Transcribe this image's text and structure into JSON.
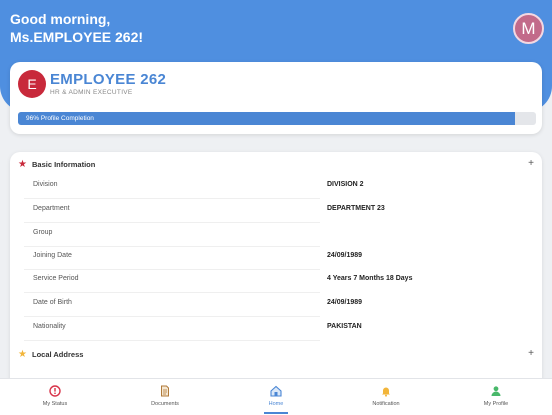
{
  "header": {
    "greeting_line1": "Good morning,",
    "greeting_line2": "Ms.EMPLOYEE 262!",
    "avatar_initial": "M",
    "background_color": "#4f8fe0"
  },
  "profile": {
    "initial": "E",
    "name": "EMPLOYEE 262",
    "role": "HR & ADMIN EXECUTIVE",
    "completion_percent": 96,
    "completion_label": "96% Profile Completion"
  },
  "sections": {
    "basic": {
      "title": "Basic Information",
      "icon": "star-icon",
      "icon_color": "#c8293b",
      "rows": [
        {
          "label": "Division",
          "value": "DIVISION 2"
        },
        {
          "label": "Department",
          "value": "DEPARTMENT 23"
        },
        {
          "label": "Group",
          "value": ""
        },
        {
          "label": "Joining Date",
          "value": "24/09/1989"
        },
        {
          "label": "Service Period",
          "value": "4 Years 7 Months 18 Days"
        },
        {
          "label": "Date of Birth",
          "value": "24/09/1989"
        },
        {
          "label": "Nationality",
          "value": "PAKISTAN"
        }
      ]
    },
    "local_address": {
      "title": "Local Address",
      "icon": "star-icon",
      "icon_color": "#f2b53a"
    }
  },
  "bottom_nav": {
    "items": [
      {
        "label": "My Status",
        "icon": "alert-circle-icon",
        "color": "#d8344a"
      },
      {
        "label": "Documents",
        "icon": "document-icon",
        "color": "#b07a3a"
      },
      {
        "label": "Home",
        "icon": "home-icon",
        "color": "#4a86d4"
      },
      {
        "label": "Notification",
        "icon": "bell-icon",
        "color": "#f2b53a"
      },
      {
        "label": "My Profile",
        "icon": "user-icon",
        "color": "#48b86a"
      }
    ],
    "active_index": 2
  }
}
